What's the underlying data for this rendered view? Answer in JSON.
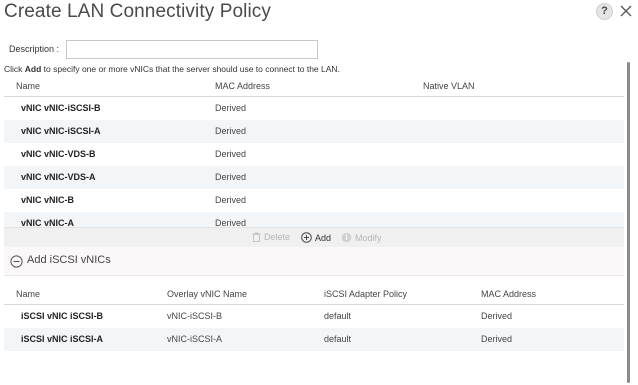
{
  "dialog": {
    "title": "Create LAN Connectivity Policy",
    "help_label": "?"
  },
  "description": {
    "label": "Description :",
    "value": ""
  },
  "instruction": {
    "prefix": "Click ",
    "bold": "Add",
    "suffix": " to specify one or more vNICs that the server should use to connect to the LAN."
  },
  "vnic_table": {
    "columns": [
      "Name",
      "MAC Address",
      "Native VLAN"
    ],
    "rows": [
      {
        "name": "vNIC vNIC-iSCSI-B",
        "mac": "Derived",
        "vlan": ""
      },
      {
        "name": "vNIC vNIC-iSCSI-A",
        "mac": "Derived",
        "vlan": ""
      },
      {
        "name": "vNIC vNIC-VDS-B",
        "mac": "Derived",
        "vlan": ""
      },
      {
        "name": "vNIC vNIC-VDS-A",
        "mac": "Derived",
        "vlan": ""
      },
      {
        "name": "vNIC vNIC-B",
        "mac": "Derived",
        "vlan": ""
      },
      {
        "name": "vNIC vNIC-A",
        "mac": "Derived",
        "vlan": ""
      }
    ]
  },
  "actions": {
    "delete": "Delete",
    "add": "Add",
    "modify": "Modify"
  },
  "iscsi_section": {
    "title": "Add iSCSI vNICs",
    "columns": [
      "Name",
      "Overlay vNIC Name",
      "iSCSI Adapter Policy",
      "MAC Address"
    ],
    "rows": [
      {
        "name": "iSCSI vNIC iSCSI-B",
        "overlay": "vNIC-iSCSI-B",
        "policy": "default",
        "mac": "Derived"
      },
      {
        "name": "iSCSI vNIC iSCSI-A",
        "overlay": "vNIC-iSCSI-A",
        "policy": "default",
        "mac": "Derived"
      }
    ]
  },
  "colors": {
    "row_alt": "#f3f6f9",
    "section_bg": "#fbf8fa",
    "disabled_text": "#b5b5b5"
  },
  "icons": {
    "help": "help-icon",
    "close": "close-icon",
    "delete": "trash-icon",
    "add": "plus-circle-icon",
    "modify": "info-circle-icon",
    "collapse": "minus-circle-icon"
  }
}
